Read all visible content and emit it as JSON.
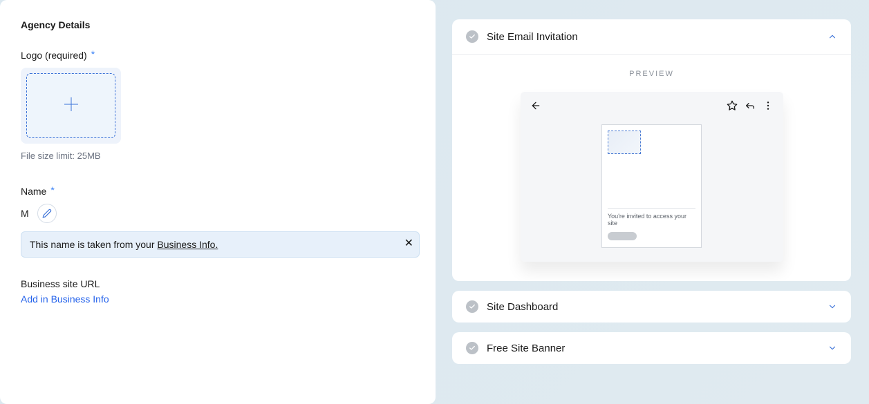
{
  "left": {
    "section_title": "Agency Details",
    "logo_label": "Logo (required)",
    "file_limit": "File size limit: 25MB",
    "name_label": "Name",
    "name_value": "M",
    "info_text_prefix": "This name is taken from your ",
    "info_link": "Business Info.",
    "biz_url_label": "Business site URL",
    "biz_url_link": "Add in Business Info"
  },
  "right": {
    "cards": [
      {
        "title": "Site Email Invitation",
        "expanded": true
      },
      {
        "title": "Site Dashboard",
        "expanded": false
      },
      {
        "title": "Free Site Banner",
        "expanded": false
      }
    ],
    "preview_label": "PREVIEW",
    "preview_text": "You're invited to access your site"
  }
}
